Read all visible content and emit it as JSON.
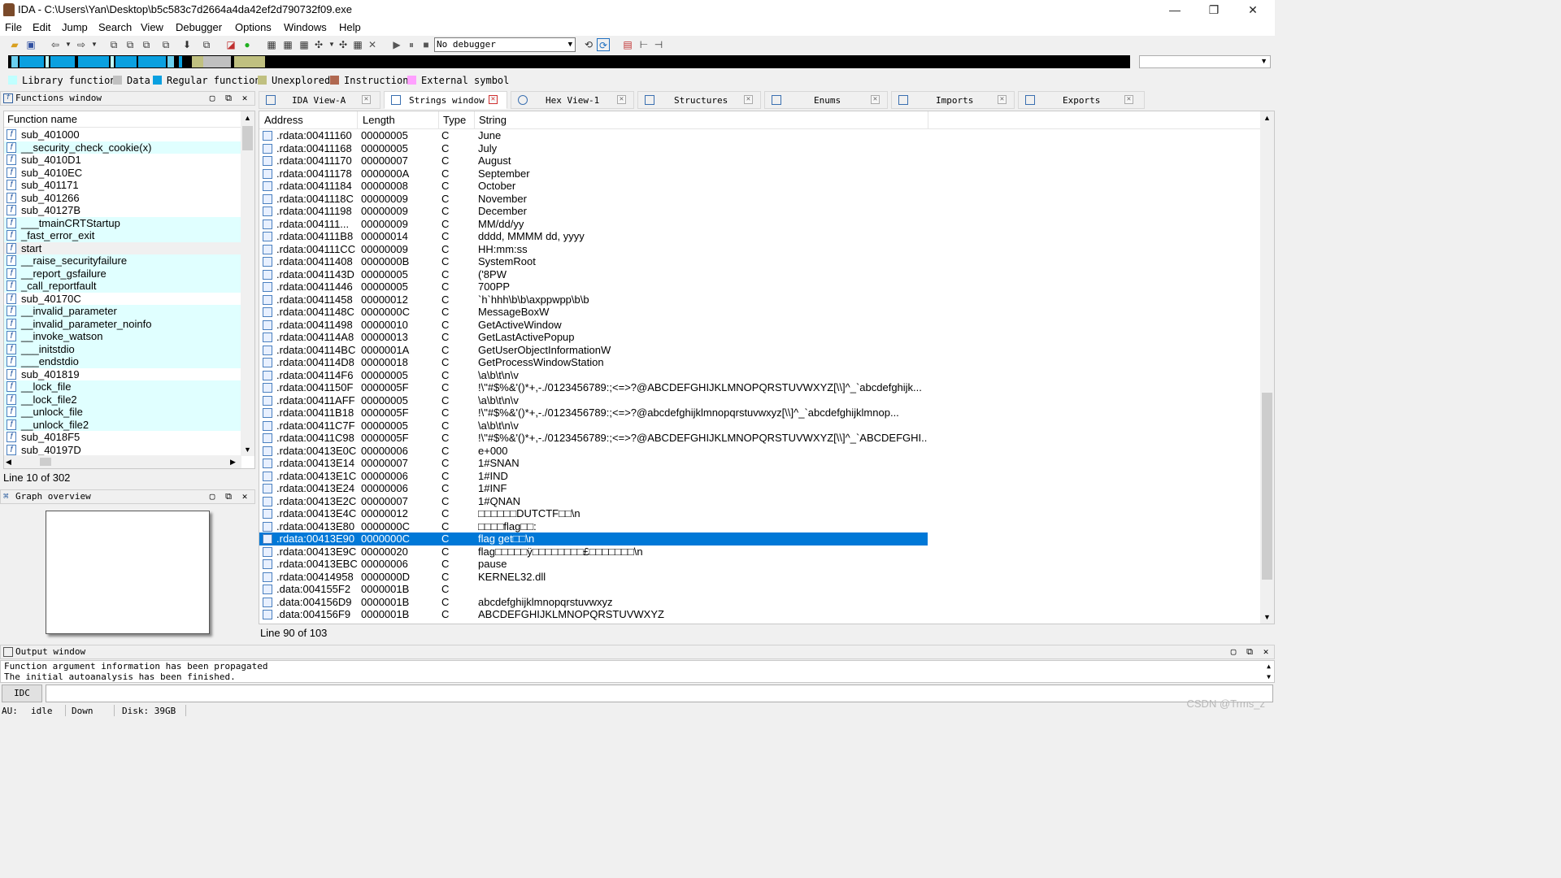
{
  "window": {
    "title": "IDA - C:\\Users\\Yan\\Desktop\\b5c583c7d2664a4da42ef2d790732f09.exe",
    "minimize": "—",
    "maximize": "❐",
    "close": "✕"
  },
  "menu": [
    "File",
    "Edit",
    "Jump",
    "Search",
    "View",
    "Debugger",
    "Options",
    "Windows",
    "Help"
  ],
  "toolbar": {
    "debugger_value": "No debugger"
  },
  "legend": [
    {
      "label": "Library function",
      "color": "#c0ffff"
    },
    {
      "label": "Data",
      "color": "#c0c0c0"
    },
    {
      "label": "Regular function",
      "color": "#0aa0e0"
    },
    {
      "label": "Unexplored",
      "color": "#c0c080"
    },
    {
      "label": "Instruction",
      "color": "#b06850"
    },
    {
      "label": "External symbol",
      "color": "#ffa0ff"
    }
  ],
  "functions_window": {
    "title": "Functions window",
    "column": "Function name",
    "items": [
      {
        "name": "sub_401000",
        "lib": false
      },
      {
        "name": "__security_check_cookie(x)",
        "lib": true
      },
      {
        "name": "sub_4010D1",
        "lib": false
      },
      {
        "name": "sub_4010EC",
        "lib": false
      },
      {
        "name": "sub_401171",
        "lib": false
      },
      {
        "name": "sub_401266",
        "lib": false
      },
      {
        "name": "sub_40127B",
        "lib": false
      },
      {
        "name": "___tmainCRTStartup",
        "lib": true
      },
      {
        "name": "_fast_error_exit",
        "lib": true
      },
      {
        "name": "start",
        "lib": true
      },
      {
        "name": "__raise_securityfailure",
        "lib": true
      },
      {
        "name": "__report_gsfailure",
        "lib": true
      },
      {
        "name": "_call_reportfault",
        "lib": true
      },
      {
        "name": "sub_40170C",
        "lib": false
      },
      {
        "name": "__invalid_parameter",
        "lib": true
      },
      {
        "name": "__invalid_parameter_noinfo",
        "lib": true
      },
      {
        "name": "__invoke_watson",
        "lib": true
      },
      {
        "name": "___initstdio",
        "lib": true
      },
      {
        "name": "___endstdio",
        "lib": true
      },
      {
        "name": "sub_401819",
        "lib": false
      },
      {
        "name": "__lock_file",
        "lib": true
      },
      {
        "name": "__lock_file2",
        "lib": true
      },
      {
        "name": "__unlock_file",
        "lib": true
      },
      {
        "name": "__unlock_file2",
        "lib": true
      },
      {
        "name": "sub_4018F5",
        "lib": false
      },
      {
        "name": "sub_40197D",
        "lib": false
      }
    ],
    "status": "Line 10 of 302"
  },
  "graph_overview": {
    "title": "Graph overview"
  },
  "tabs": [
    {
      "label": "IDA View-A"
    },
    {
      "label": "Strings window"
    },
    {
      "label": "Hex View-1"
    },
    {
      "label": "Structures"
    },
    {
      "label": "Enums"
    },
    {
      "label": "Imports"
    },
    {
      "label": "Exports"
    }
  ],
  "strings_window": {
    "columns": [
      "Address",
      "Length",
      "Type",
      "String"
    ],
    "rows": [
      [
        ".rdata:00411160",
        "00000005",
        "C",
        "June"
      ],
      [
        ".rdata:00411168",
        "00000005",
        "C",
        "July"
      ],
      [
        ".rdata:00411170",
        "00000007",
        "C",
        "August"
      ],
      [
        ".rdata:00411178",
        "0000000A",
        "C",
        "September"
      ],
      [
        ".rdata:00411184",
        "00000008",
        "C",
        "October"
      ],
      [
        ".rdata:0041118C",
        "00000009",
        "C",
        "November"
      ],
      [
        ".rdata:00411198",
        "00000009",
        "C",
        "December"
      ],
      [
        ".rdata:004111...",
        "00000009",
        "C",
        "MM/dd/yy"
      ],
      [
        ".rdata:004111B8",
        "00000014",
        "C",
        "dddd, MMMM dd, yyyy"
      ],
      [
        ".rdata:004111CC",
        "00000009",
        "C",
        "HH:mm:ss"
      ],
      [
        ".rdata:00411408",
        "0000000B",
        "C",
        "SystemRoot"
      ],
      [
        ".rdata:0041143D",
        "00000005",
        "C",
        "('8PW"
      ],
      [
        ".rdata:00411446",
        "00000005",
        "C",
        "700PP"
      ],
      [
        ".rdata:00411458",
        "00000012",
        "C",
        "`h`hhh\\b\\b\\axppwpp\\b\\b"
      ],
      [
        ".rdata:0041148C",
        "0000000C",
        "C",
        "MessageBoxW"
      ],
      [
        ".rdata:00411498",
        "00000010",
        "C",
        "GetActiveWindow"
      ],
      [
        ".rdata:004114A8",
        "00000013",
        "C",
        "GetLastActivePopup"
      ],
      [
        ".rdata:004114BC",
        "0000001A",
        "C",
        "GetUserObjectInformationW"
      ],
      [
        ".rdata:004114D8",
        "00000018",
        "C",
        "GetProcessWindowStation"
      ],
      [
        ".rdata:004114F6",
        "00000005",
        "C",
        "\\a\\b\\t\\n\\v"
      ],
      [
        ".rdata:0041150F",
        "0000005F",
        "C",
        " !\\\"#$%&'()*+,-./0123456789:;<=>?@ABCDEFGHIJKLMNOPQRSTUVWXYZ[\\\\]^_`abcdefghijk..."
      ],
      [
        ".rdata:00411AFF",
        "00000005",
        "C",
        "\\a\\b\\t\\n\\v"
      ],
      [
        ".rdata:00411B18",
        "0000005F",
        "C",
        " !\\\"#$%&'()*+,-./0123456789:;<=>?@abcdefghijklmnopqrstuvwxyz[\\\\]^_`abcdefghijklmnop..."
      ],
      [
        ".rdata:00411C7F",
        "00000005",
        "C",
        "\\a\\b\\t\\n\\v"
      ],
      [
        ".rdata:00411C98",
        "0000005F",
        "C",
        " !\\\"#$%&'()*+,-./0123456789:;<=>?@ABCDEFGHIJKLMNOPQRSTUVWXYZ[\\\\]^_`ABCDEFGHI..."
      ],
      [
        ".rdata:00413E0C",
        "00000006",
        "C",
        "e+000"
      ],
      [
        ".rdata:00413E14",
        "00000007",
        "C",
        "1#SNAN"
      ],
      [
        ".rdata:00413E1C",
        "00000006",
        "C",
        "1#IND"
      ],
      [
        ".rdata:00413E24",
        "00000006",
        "C",
        "1#INF"
      ],
      [
        ".rdata:00413E2C",
        "00000007",
        "C",
        "1#QNAN"
      ],
      [
        ".rdata:00413E4C",
        "00000012",
        "C",
        "□□□□□□DUTCTF□□\\n"
      ],
      [
        ".rdata:00413E80",
        "0000000C",
        "C",
        "□□□□flag□□:"
      ],
      [
        ".rdata:00413E90",
        "0000000C",
        "C",
        "flag get□□\\n"
      ],
      [
        ".rdata:00413E9C",
        "00000020",
        "C",
        "flag□□□□□ӱ□□□□□□□□£□□□□□□□\\n"
      ],
      [
        ".rdata:00413EBC",
        "00000006",
        "C",
        "pause"
      ],
      [
        ".rdata:00414958",
        "0000000D",
        "C",
        "KERNEL32.dll"
      ],
      [
        ".data:004155F2",
        "0000001B",
        "C",
        ""
      ],
      [
        ".data:004156D9",
        "0000001B",
        "C",
        "abcdefghijklmnopqrstuvwxyz"
      ],
      [
        ".data:004156F9",
        "0000001B",
        "C",
        "ABCDEFGHIJKLMNOPQRSTUVWXYZ"
      ]
    ],
    "selected_index": 32,
    "status": "Line 90 of 103"
  },
  "output_window": {
    "title": "Output window",
    "lines": [
      "Function argument information has been propagated",
      "The initial autoanalysis has been finished."
    ],
    "idc_label": "IDC"
  },
  "statusbar": {
    "au_label": "AU:",
    "au_value": "idle",
    "direction": "Down",
    "disk": "Disk: 39GB"
  },
  "watermark": "CSDN @Trms_z"
}
